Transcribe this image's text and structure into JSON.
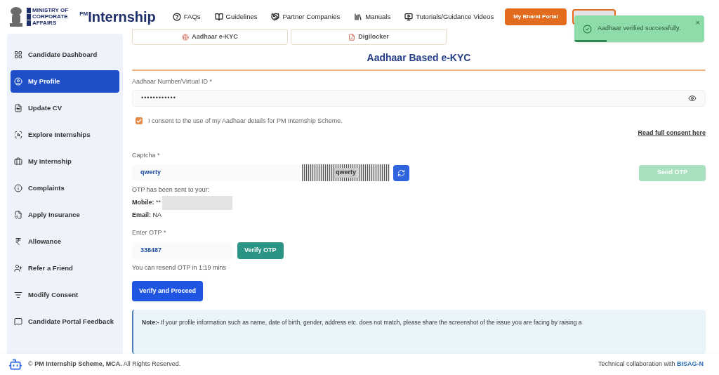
{
  "header": {
    "ministry_lines": [
      "MINISTRY OF",
      "CORPORATE",
      "AFFAIRS"
    ],
    "logo_pm": "PM",
    "logo_word": "Internship",
    "nav": [
      {
        "label": "FAQs",
        "kind": "faq"
      },
      {
        "label": "Guidelines",
        "kind": "guide"
      },
      {
        "label": "Partner Companies",
        "kind": "partner"
      },
      {
        "label": "Manuals",
        "kind": "manual"
      },
      {
        "label": "Tutorials/Guidance Videos",
        "kind": "video"
      }
    ],
    "portal_button": "My Bharat Portal"
  },
  "toast": {
    "message": "Aadhaar verified successfully.",
    "close": "×",
    "level": 0.25
  },
  "sidebar": {
    "items": [
      {
        "label": "Candidate Dashboard",
        "kind": "dashboard",
        "selected": false
      },
      {
        "label": "My Profile",
        "kind": "profile",
        "selected": true
      },
      {
        "label": "Update CV",
        "kind": "cv",
        "selected": false
      },
      {
        "label": "Explore Internships",
        "kind": "explore",
        "selected": false
      },
      {
        "label": "My Internship",
        "kind": "internship",
        "selected": false
      },
      {
        "label": "Complaints",
        "kind": "complaints",
        "selected": false
      },
      {
        "label": "Apply Insurance",
        "kind": "insurance",
        "selected": false
      },
      {
        "label": "Allowance",
        "kind": "allowance",
        "selected": false
      },
      {
        "label": "Refer a Friend",
        "kind": "refer",
        "selected": false
      },
      {
        "label": "Modify Consent",
        "kind": "consent",
        "selected": false
      },
      {
        "label": "Candidate Portal Feedback",
        "kind": "feedback",
        "selected": false
      }
    ]
  },
  "method_tabs": [
    {
      "label": "Aadhaar e-KYC",
      "kind": "aadhaar"
    },
    {
      "label": "Digilocker",
      "kind": "digilocker"
    }
  ],
  "form": {
    "title": "Aadhaar Based e-KYC",
    "required_mark": "*",
    "aadhaar_label": "Aadhaar Number/Virtual ID",
    "aadhaar_value": "••••••••••••",
    "consent": {
      "text": "I consent to the use of my Aadhaar details for PM Internship Scheme.",
      "checked": true
    },
    "consent_link": "Read full consent here",
    "captcha_label": "Captcha",
    "captcha_value": "qwerty",
    "captcha_image": "qwerty",
    "send_otp": {
      "label": "Send OTP",
      "disabled": true
    },
    "otp_sent": "OTP has been sent to your:",
    "mobile_label": "Mobile:",
    "mobile_value": "**",
    "email_label": "Email:",
    "email_value": "NA",
    "otp_label": "Enter OTP",
    "otp_value": "338487",
    "verify_otp": "Verify OTP",
    "resend": "You can resend OTP in 1:19 mins",
    "proceed": "Verify and Proceed",
    "note": "**Note:-** If your profile information such as name, date of birth, gender, address etc. does not match, please share the screenshot of the issue you are facing by raising a"
  },
  "footer": {
    "copyright": "© **PM Internship Scheme, MCA.** All Rights Reserved.",
    "collab": "Technical collaboration with",
    "collab_org": "BISAG-N"
  }
}
